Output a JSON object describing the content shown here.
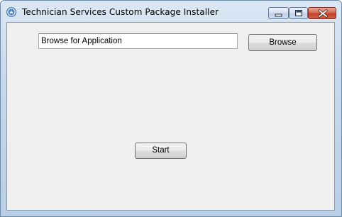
{
  "window": {
    "title": "Technician Services Custom Package Installer",
    "icon": "app-icon"
  },
  "caption_buttons": {
    "minimize_icon": "minimize-icon",
    "maximize_icon": "maximize-icon",
    "close_icon": "close-icon"
  },
  "form": {
    "path_input": {
      "value": "Browse for Application",
      "placeholder": ""
    },
    "browse_label": "Browse",
    "start_label": "Start"
  },
  "colors": {
    "titlebar": "#c6d8ec",
    "client_background": "#f0f0f0",
    "close_button": "#c2422b"
  }
}
